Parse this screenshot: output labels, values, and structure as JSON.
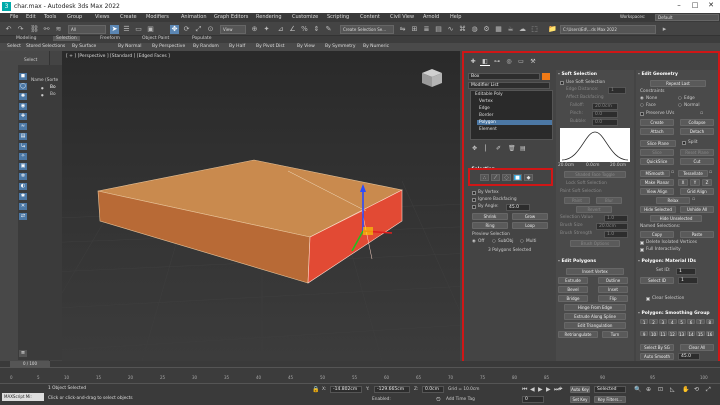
{
  "window": {
    "title": "char.max - Autodesk 3ds Max 2022",
    "app_icon": "3",
    "minimize": "–",
    "maximize": "□",
    "close": "✕"
  },
  "menu": [
    "File",
    "Edit",
    "Tools",
    "Group",
    "Views",
    "Create",
    "Modifiers",
    "Animation",
    "Graph Editors",
    "Rendering",
    "Customize",
    "Scripting",
    "Content",
    "Civil View",
    "Arnold",
    "Help"
  ],
  "workspaces": {
    "label": "Workspaces:",
    "value": "Default"
  },
  "toolbar": {
    "filter": "All",
    "view": "View",
    "selection_set": "Create Selection Se...",
    "project_path": "C:\\Users\\Ed\\...ds Max 2022"
  },
  "ribbon_tabs": [
    "Modeling",
    "Selection",
    "Freeform",
    "Object Paint",
    "Populate"
  ],
  "selection_tools": [
    "Select",
    "Stored Selections",
    "By Surface",
    "By Normal",
    "By Perspective",
    "By Random",
    "By Half",
    "By Pivot Dist",
    "By View",
    "By Symmetry",
    "By Numeric"
  ],
  "left": {
    "select_label": "Select",
    "name_header": "Name (Sorte",
    "items": [
      "Bo",
      "Bo"
    ]
  },
  "viewport": {
    "label": "[ + ] [Perspective ] [Standard ] [Edged Faces ]"
  },
  "cmd": {
    "object_name": "Box",
    "modifier_list": "Modifier List",
    "stack": [
      "Editable Poly",
      "Vertex",
      "Edge",
      "Border",
      "Polygon",
      "Element"
    ],
    "stack_selected": 4,
    "selection": {
      "header": "Selection",
      "by_vertex": "By Vertex",
      "ignore_backfacing": "Ignore Backfacing",
      "by_angle": "By Angle:",
      "angle_value": "45.0",
      "shrink": "Shrink",
      "grow": "Grow",
      "ring": "Ring",
      "loop": "Loop",
      "preview_selection": "Preview Selection",
      "preview_off": "Off",
      "preview_subobj": "SubObj",
      "preview_multi": "Multi",
      "status": "3 Polygons Selected"
    },
    "soft": {
      "header": "Soft Selection",
      "use_soft": "Use Soft Selection",
      "edge_distance": "Edge Distance:",
      "edge_distance_value": "1",
      "affect_backfacing": "Affect Backfacing",
      "falloff": "Falloff:",
      "falloff_value": "20.0cm",
      "pinch": "Pinch:",
      "pinch_value": "0.0",
      "bubble": "Bubble:",
      "bubble_value": "0.0",
      "curve_left": "20.0cm",
      "curve_mid": "0.0cm",
      "curve_right": "20.0cm",
      "shaded_face_toggle": "Shaded Face Toggle",
      "lock_soft": "Lock Soft Selection",
      "paint_soft": "Paint Soft Selection",
      "paint": "Paint",
      "blur": "Blur",
      "revert": "Revert",
      "selection_value": "Selection Value",
      "selection_value_v": "1.0",
      "brush_size": "Brush Size",
      "brush_size_v": "20.0cm",
      "brush_strength": "Brush Strength",
      "brush_strength_v": "1.0",
      "brush_options": "Brush Options"
    },
    "edit_polygons": {
      "header": "Edit Polygons",
      "insert_vertex": "Insert Vertex",
      "extrude": "Extrude",
      "outline": "Outline",
      "bevel": "Bevel",
      "inset": "Inset",
      "bridge": "Bridge",
      "flip": "Flip",
      "hinge": "Hinge From Edge",
      "extrude_spline": "Extrude Along Spline",
      "edit_tri": "Edit Triangulation",
      "retriangulate": "Retriangulate",
      "turn": "Turn"
    },
    "edit_geometry": {
      "header": "Edit Geometry",
      "repeat_last": "Repeat Last",
      "constraints": "Constraints",
      "none": "None",
      "edge": "Edge",
      "face": "Face",
      "normal": "Normal",
      "preserve_uvs": "Preserve UVs",
      "create": "Create",
      "collapse": "Collapse",
      "attach": "Attach",
      "detach": "Detach",
      "slice_plane": "Slice Plane",
      "split": "Split",
      "slice": "Slice",
      "reset_plane": "Reset Plane",
      "quickslice": "QuickSlice",
      "cut": "Cut",
      "msmooth": "MSmooth",
      "tessellate": "Tessellate",
      "make_planar": "Make Planar",
      "x": "X",
      "y": "Y",
      "z": "Z",
      "view_align": "View Align",
      "grid_align": "Grid Align",
      "relax": "Relax",
      "hide_selected": "Hide Selected",
      "unhide_all": "Unhide All",
      "hide_unselected": "Hide Unselected",
      "named_selections": "Named Selections:",
      "copy": "Copy",
      "paste": "Paste",
      "delete_isolated": "Delete Isolated Vertices",
      "full_interactivity": "Full Interactivity"
    },
    "material_ids": {
      "header": "Polygon: Material IDs",
      "set_id": "Set ID:",
      "set_id_value": "1",
      "select_id": "Select ID",
      "select_id_value": "1",
      "clear_selection": "Clear Selection"
    },
    "smoothing": {
      "header": "Polygon: Smoothing Group",
      "select_by_sg": "Select By SG",
      "clear_all": "Clear All",
      "auto_smooth": "Auto Smooth",
      "auto_smooth_value": "45.0"
    }
  },
  "timeline": {
    "frame": "0 / 100",
    "ticks": [
      "0",
      "5",
      "10",
      "15",
      "20",
      "25",
      "30",
      "35",
      "40",
      "45",
      "50",
      "55",
      "60",
      "65",
      "70",
      "75",
      "80",
      "85",
      "90",
      "95",
      "100"
    ]
  },
  "status": {
    "maxscript": "MAXScript Mi:",
    "selected": "1 Object Selected",
    "prompt": "Click or click-and-drag to select objects",
    "x_label": "X:",
    "x_value": "-14.802cm",
    "y_label": "Y:",
    "y_value": "-129.665cm",
    "z_label": "Z:",
    "z_value": "0.0cm",
    "grid": "Grid = 10.0cm",
    "add_time_tag": "Add Time Tag",
    "enabled": "Enabled:",
    "auto_key": "Auto Key",
    "selected_key": "Selected",
    "set_key": "Set Key",
    "key_filters": "Key Filters...",
    "current_frame": "0"
  },
  "colors": {
    "accent": "#5b86b3",
    "highlight": "#d01616",
    "polygon": "#c8693e",
    "poly_selected": "#e24a34",
    "swatch": "#f07a16"
  }
}
